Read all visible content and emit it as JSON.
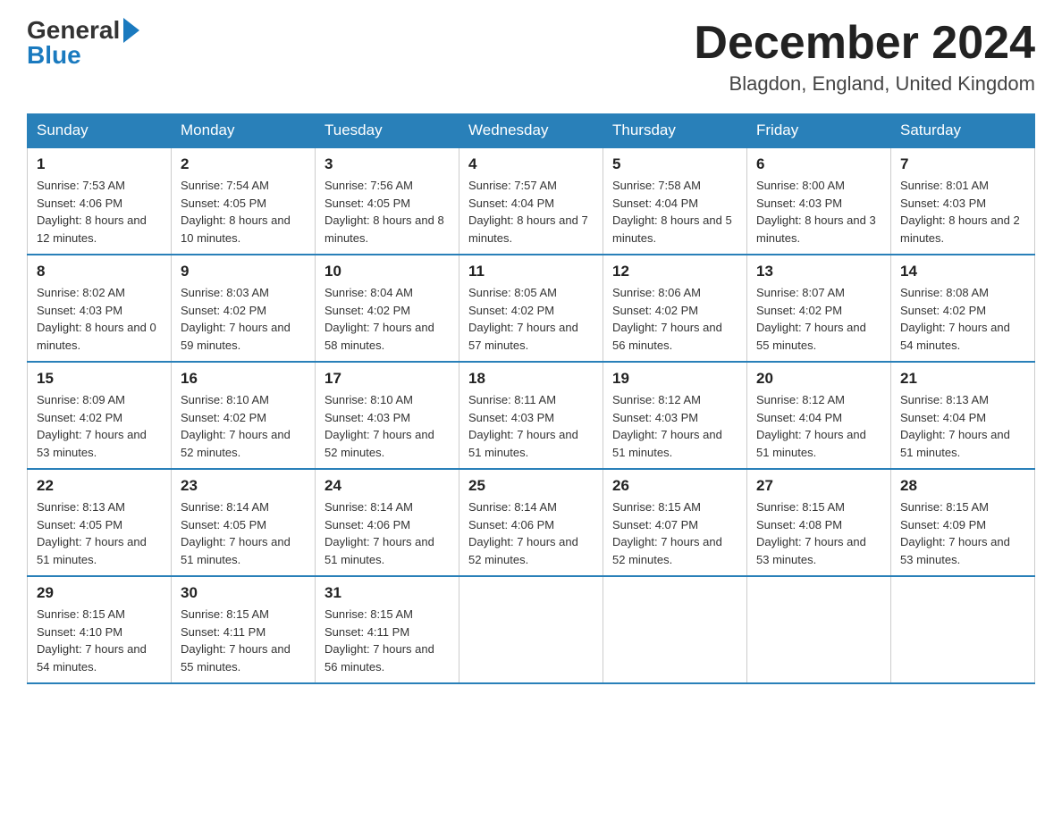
{
  "header": {
    "logo_general": "General",
    "logo_blue": "Blue",
    "month_title": "December 2024",
    "location": "Blagdon, England, United Kingdom"
  },
  "weekdays": [
    "Sunday",
    "Monday",
    "Tuesday",
    "Wednesday",
    "Thursday",
    "Friday",
    "Saturday"
  ],
  "weeks": [
    [
      {
        "day": "1",
        "sunrise": "7:53 AM",
        "sunset": "4:06 PM",
        "daylight": "8 hours and 12 minutes."
      },
      {
        "day": "2",
        "sunrise": "7:54 AM",
        "sunset": "4:05 PM",
        "daylight": "8 hours and 10 minutes."
      },
      {
        "day": "3",
        "sunrise": "7:56 AM",
        "sunset": "4:05 PM",
        "daylight": "8 hours and 8 minutes."
      },
      {
        "day": "4",
        "sunrise": "7:57 AM",
        "sunset": "4:04 PM",
        "daylight": "8 hours and 7 minutes."
      },
      {
        "day": "5",
        "sunrise": "7:58 AM",
        "sunset": "4:04 PM",
        "daylight": "8 hours and 5 minutes."
      },
      {
        "day": "6",
        "sunrise": "8:00 AM",
        "sunset": "4:03 PM",
        "daylight": "8 hours and 3 minutes."
      },
      {
        "day": "7",
        "sunrise": "8:01 AM",
        "sunset": "4:03 PM",
        "daylight": "8 hours and 2 minutes."
      }
    ],
    [
      {
        "day": "8",
        "sunrise": "8:02 AM",
        "sunset": "4:03 PM",
        "daylight": "8 hours and 0 minutes."
      },
      {
        "day": "9",
        "sunrise": "8:03 AM",
        "sunset": "4:02 PM",
        "daylight": "7 hours and 59 minutes."
      },
      {
        "day": "10",
        "sunrise": "8:04 AM",
        "sunset": "4:02 PM",
        "daylight": "7 hours and 58 minutes."
      },
      {
        "day": "11",
        "sunrise": "8:05 AM",
        "sunset": "4:02 PM",
        "daylight": "7 hours and 57 minutes."
      },
      {
        "day": "12",
        "sunrise": "8:06 AM",
        "sunset": "4:02 PM",
        "daylight": "7 hours and 56 minutes."
      },
      {
        "day": "13",
        "sunrise": "8:07 AM",
        "sunset": "4:02 PM",
        "daylight": "7 hours and 55 minutes."
      },
      {
        "day": "14",
        "sunrise": "8:08 AM",
        "sunset": "4:02 PM",
        "daylight": "7 hours and 54 minutes."
      }
    ],
    [
      {
        "day": "15",
        "sunrise": "8:09 AM",
        "sunset": "4:02 PM",
        "daylight": "7 hours and 53 minutes."
      },
      {
        "day": "16",
        "sunrise": "8:10 AM",
        "sunset": "4:02 PM",
        "daylight": "7 hours and 52 minutes."
      },
      {
        "day": "17",
        "sunrise": "8:10 AM",
        "sunset": "4:03 PM",
        "daylight": "7 hours and 52 minutes."
      },
      {
        "day": "18",
        "sunrise": "8:11 AM",
        "sunset": "4:03 PM",
        "daylight": "7 hours and 51 minutes."
      },
      {
        "day": "19",
        "sunrise": "8:12 AM",
        "sunset": "4:03 PM",
        "daylight": "7 hours and 51 minutes."
      },
      {
        "day": "20",
        "sunrise": "8:12 AM",
        "sunset": "4:04 PM",
        "daylight": "7 hours and 51 minutes."
      },
      {
        "day": "21",
        "sunrise": "8:13 AM",
        "sunset": "4:04 PM",
        "daylight": "7 hours and 51 minutes."
      }
    ],
    [
      {
        "day": "22",
        "sunrise": "8:13 AM",
        "sunset": "4:05 PM",
        "daylight": "7 hours and 51 minutes."
      },
      {
        "day": "23",
        "sunrise": "8:14 AM",
        "sunset": "4:05 PM",
        "daylight": "7 hours and 51 minutes."
      },
      {
        "day": "24",
        "sunrise": "8:14 AM",
        "sunset": "4:06 PM",
        "daylight": "7 hours and 51 minutes."
      },
      {
        "day": "25",
        "sunrise": "8:14 AM",
        "sunset": "4:06 PM",
        "daylight": "7 hours and 52 minutes."
      },
      {
        "day": "26",
        "sunrise": "8:15 AM",
        "sunset": "4:07 PM",
        "daylight": "7 hours and 52 minutes."
      },
      {
        "day": "27",
        "sunrise": "8:15 AM",
        "sunset": "4:08 PM",
        "daylight": "7 hours and 53 minutes."
      },
      {
        "day": "28",
        "sunrise": "8:15 AM",
        "sunset": "4:09 PM",
        "daylight": "7 hours and 53 minutes."
      }
    ],
    [
      {
        "day": "29",
        "sunrise": "8:15 AM",
        "sunset": "4:10 PM",
        "daylight": "7 hours and 54 minutes."
      },
      {
        "day": "30",
        "sunrise": "8:15 AM",
        "sunset": "4:11 PM",
        "daylight": "7 hours and 55 minutes."
      },
      {
        "day": "31",
        "sunrise": "8:15 AM",
        "sunset": "4:11 PM",
        "daylight": "7 hours and 56 minutes."
      },
      null,
      null,
      null,
      null
    ]
  ]
}
